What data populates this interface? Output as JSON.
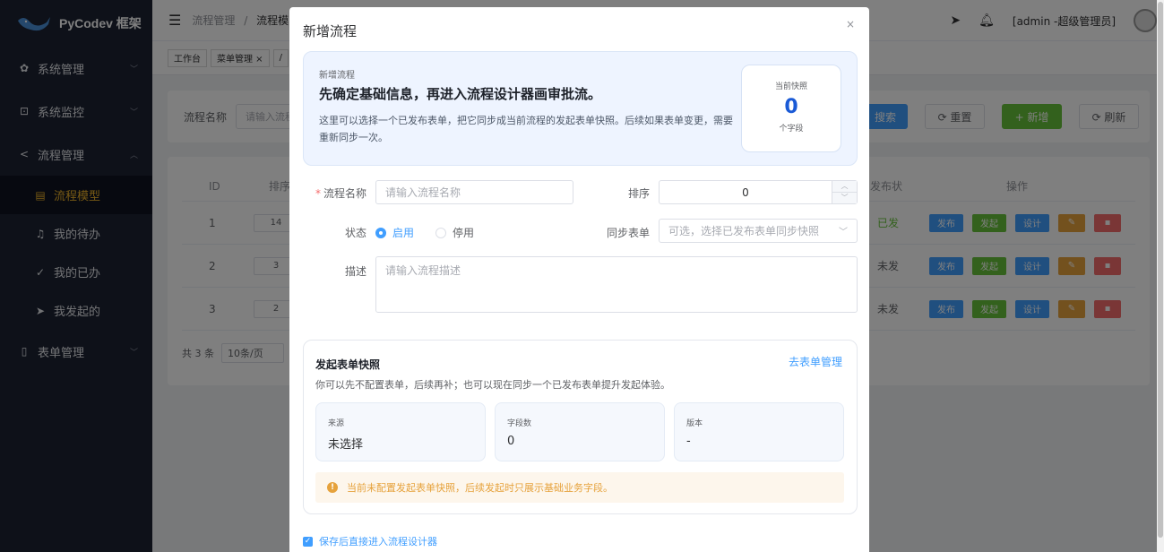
{
  "app": {
    "logo_text": "PyCodev 框架"
  },
  "sidebar": {
    "items": [
      {
        "label": "系统管理",
        "icon": "gear-icon"
      },
      {
        "label": "系统监控",
        "icon": "monitor-icon"
      },
      {
        "label": "流程管理",
        "icon": "share-icon"
      },
      {
        "label": "表单管理",
        "icon": "form-icon"
      }
    ],
    "sub_items": [
      {
        "label": "流程模型",
        "icon": "document-icon",
        "active": true
      },
      {
        "label": "我的待办",
        "icon": "bell-icon"
      },
      {
        "label": "我的已办",
        "icon": "check-icon"
      },
      {
        "label": "我发起的",
        "icon": "send-icon"
      }
    ]
  },
  "header": {
    "breadcrumb_root": "流程管理",
    "breadcrumb_sep": "/",
    "breadcrumb_current": "流程模",
    "user": "[admin -超级管理员]"
  },
  "tags": [
    "工作台",
    "菜单管理 ×",
    "/"
  ],
  "search": {
    "label": "流程名称",
    "placeholder": "请输入流程",
    "search_btn": "搜索",
    "reset_btn": "⟳ 重置",
    "add_btn": "+ 新增",
    "refresh_btn": "⟳ 刷新"
  },
  "table": {
    "headers": {
      "id": "ID",
      "sort": "排序",
      "publish": "发布状",
      "ops": "操作"
    },
    "rows": [
      {
        "id": "1",
        "sort": "14",
        "status": "已发"
      },
      {
        "id": "2",
        "sort": "3",
        "status": "未发"
      },
      {
        "id": "3",
        "sort": "2",
        "status": "未发"
      }
    ],
    "op_labels": {
      "publish": "发布",
      "start": "发起",
      "design": "设计"
    },
    "pager": {
      "total": "共 3 条",
      "size": "10条/页"
    }
  },
  "dialog": {
    "title": "新增流程",
    "close": "×",
    "hero": {
      "eyebrow": "新增流程",
      "title": "先确定基础信息，再进入流程设计器画审批流。",
      "desc": "这里可以选择一个已发布表单，把它同步成当前流程的发起表单快照。后续如果表单变更，需要重新同步一次。",
      "snapshot_label": "当前快照",
      "snapshot_count": "0",
      "snapshot_unit": "个字段"
    },
    "form": {
      "name_label": "流程名称",
      "name_placeholder": "请输入流程名称",
      "sort_label": "排序",
      "sort_value": "0",
      "status_label": "状态",
      "status_on": "启用",
      "status_off": "停用",
      "sync_label": "同步表单",
      "sync_placeholder": "可选，选择已发布表单同步快照",
      "desc_label": "描述",
      "desc_placeholder": "请输入流程描述"
    },
    "snapshot_card": {
      "title": "发起表单快照",
      "link": "去表单管理",
      "desc": "你可以先不配置表单，后续再补；也可以现在同步一个已发布表单提升发起体验。",
      "boxes": [
        {
          "label": "来源",
          "value": "未选择"
        },
        {
          "label": "字段数",
          "value": "0"
        },
        {
          "label": "版本",
          "value": "-"
        }
      ],
      "warning": "当前未配置发起表单快照，后续发起时只展示基础业务字段。"
    },
    "checkbox_label": "保存后直接进入流程设计器"
  }
}
